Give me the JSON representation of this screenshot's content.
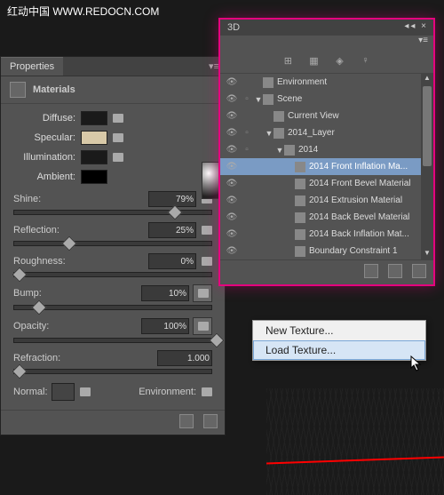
{
  "watermark": "红动中国 WWW.REDOCN.COM",
  "propertiesPanel": {
    "tab": "Properties",
    "header": "Materials",
    "colors": {
      "diffuse": {
        "label": "Diffuse:",
        "hex": "#1a1a1a"
      },
      "specular": {
        "label": "Specular:",
        "hex": "#d8c9a8"
      },
      "illumination": {
        "label": "Illumination:",
        "hex": "#1a1a1a"
      },
      "ambient": {
        "label": "Ambient:",
        "hex": "#000000"
      }
    },
    "sliders": {
      "shine": {
        "label": "Shine:",
        "value": "79%",
        "pos": 79
      },
      "reflection": {
        "label": "Reflection:",
        "value": "25%",
        "pos": 25
      },
      "roughness": {
        "label": "Roughness:",
        "value": "0%",
        "pos": 0
      },
      "bump": {
        "label": "Bump:",
        "value": "10%",
        "pos": 10
      },
      "opacity": {
        "label": "Opacity:",
        "value": "100%",
        "pos": 100
      },
      "refraction": {
        "label": "Refraction:",
        "value": "1.000",
        "pos": 0
      }
    },
    "normal": "Normal:",
    "environment": "Environment:"
  },
  "panel3d": {
    "title": "3D",
    "items": [
      {
        "label": "Environment",
        "indent": 0,
        "icon": "env",
        "arrow": "",
        "sel": false,
        "extra": ""
      },
      {
        "label": "Scene",
        "indent": 0,
        "icon": "scene",
        "arrow": "▼",
        "sel": false,
        "extra": "▫"
      },
      {
        "label": "Current View",
        "indent": 1,
        "icon": "cam",
        "arrow": "",
        "sel": false,
        "extra": ""
      },
      {
        "label": "2014_Layer",
        "indent": 1,
        "icon": "layer",
        "arrow": "▼",
        "sel": false,
        "extra": "▫"
      },
      {
        "label": "2014",
        "indent": 2,
        "icon": "text",
        "arrow": "▼",
        "sel": false,
        "extra": "▫"
      },
      {
        "label": "2014 Front Inflation Ma...",
        "indent": 3,
        "icon": "mat",
        "arrow": "",
        "sel": true,
        "extra": ""
      },
      {
        "label": "2014 Front Bevel Material",
        "indent": 3,
        "icon": "mat",
        "arrow": "",
        "sel": false,
        "extra": ""
      },
      {
        "label": "2014 Extrusion Material",
        "indent": 3,
        "icon": "mat",
        "arrow": "",
        "sel": false,
        "extra": ""
      },
      {
        "label": "2014 Back Bevel Material",
        "indent": 3,
        "icon": "mat",
        "arrow": "",
        "sel": false,
        "extra": ""
      },
      {
        "label": "2014 Back Inflation Mat...",
        "indent": 3,
        "icon": "mat",
        "arrow": "",
        "sel": false,
        "extra": ""
      },
      {
        "label": "Boundary Constraint 1",
        "indent": 3,
        "icon": "bound",
        "arrow": "",
        "sel": false,
        "extra": ""
      }
    ]
  },
  "contextMenu": {
    "items": [
      {
        "label": "New Texture...",
        "hover": false
      },
      {
        "label": "Load Texture...",
        "hover": true
      }
    ]
  }
}
